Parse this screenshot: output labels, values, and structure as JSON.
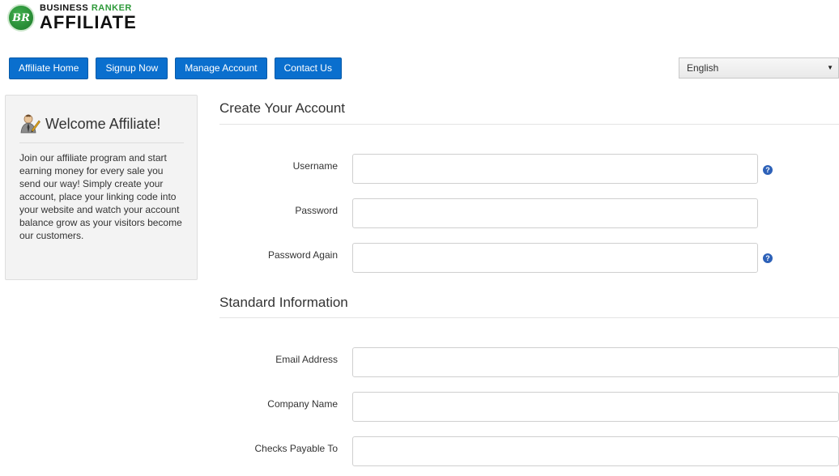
{
  "logo": {
    "badge": "BR",
    "line1_a": "BUSINESS",
    "line1_b": "RANKER",
    "line2": "AFFILIATE"
  },
  "nav": {
    "items": [
      {
        "label": "Affiliate Home"
      },
      {
        "label": "Signup Now"
      },
      {
        "label": "Manage Account"
      },
      {
        "label": "Contact Us"
      }
    ]
  },
  "language": {
    "selected": "English"
  },
  "sidebar": {
    "icon": "affiliate-person-icon",
    "title": "Welcome Affiliate!",
    "text": "Join our affiliate program and start earning money for every sale you send our way! Simply create your account, place your linking code into your website and watch your account balance grow as your visitors become our customers."
  },
  "create_account": {
    "title": "Create Your Account",
    "fields": [
      {
        "label": "Username",
        "value": ""
      },
      {
        "label": "Password",
        "value": ""
      },
      {
        "label": "Password Again",
        "value": ""
      }
    ]
  },
  "standard_info": {
    "title": "Standard Information",
    "fields": [
      {
        "label": "Email Address",
        "value": ""
      },
      {
        "label": "Company Name",
        "value": ""
      },
      {
        "label": "Checks Payable To",
        "value": ""
      }
    ]
  },
  "help_icon_glyph": "?",
  "colors": {
    "nav_button": "#0a6fce",
    "logo_green": "#2e9a3a",
    "help_icon": "#2d61b8"
  }
}
